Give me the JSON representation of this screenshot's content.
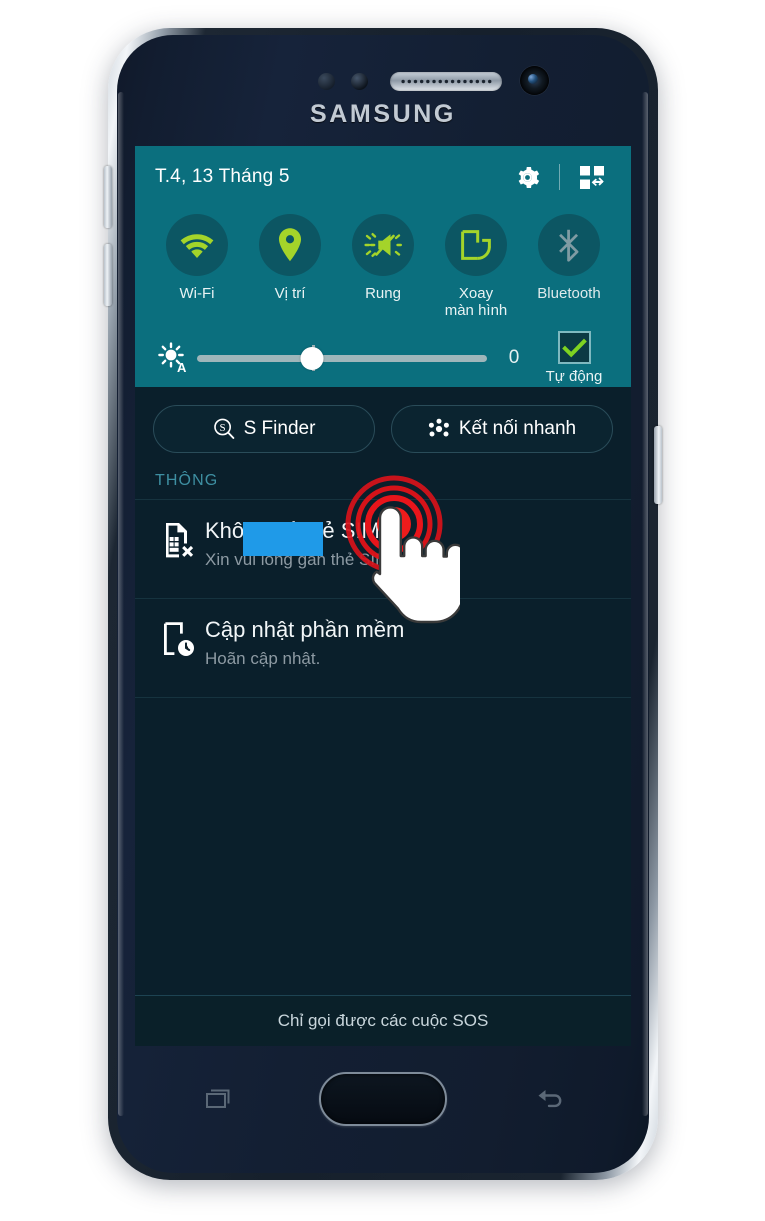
{
  "device": {
    "brand_logo": "SAMSUNG",
    "buttons": {
      "volume_up": "volume-up-button",
      "volume_down": "volume-down-button",
      "power": "power-button",
      "home": "home-button",
      "recents": "recents-key",
      "back": "back-key"
    }
  },
  "status_bar": {
    "date": "T.4, 13 Tháng 5",
    "settings_icon": "gear-icon",
    "edit_toggles_icon": "quick-settings-edit-icon"
  },
  "quick_toggles": [
    {
      "label": "Wi-Fi",
      "icon": "wifi-icon",
      "state": "on"
    },
    {
      "label": "Vị trí",
      "icon": "location-pin-icon",
      "state": "on"
    },
    {
      "label": "Rung",
      "icon": "vibrate-mute-icon",
      "state": "on"
    },
    {
      "label": "Xoay\nmàn hình",
      "label_line1": "Xoay",
      "label_line2": "màn hình",
      "icon": "screen-rotation-icon",
      "state": "on"
    },
    {
      "label": "Bluetooth",
      "icon": "bluetooth-icon",
      "state": "off"
    }
  ],
  "brightness": {
    "icon": "auto-brightness-icon",
    "value": "0",
    "auto_label": "Tự động",
    "auto_checked": true,
    "slider_percent": 40
  },
  "action_buttons": [
    {
      "label": "S Finder",
      "icon": "s-finder-icon"
    },
    {
      "label": "Kết nối nhanh",
      "icon": "quick-connect-icon"
    }
  ],
  "notifications": {
    "section_label": "THÔNG",
    "items": [
      {
        "icon": "sim-card-error-icon",
        "title": "Không có thẻ SIM",
        "title_visible": "Kh         ó thẻ SIM",
        "subtitle": "Xin vui lòng gắn thẻ SIM.",
        "redacted": true
      },
      {
        "icon": "software-update-icon",
        "title": "Cập nhật phần mềm",
        "subtitle": "Hoãn cập nhật.",
        "redacted": false
      }
    ]
  },
  "screen_bottom_bar": {
    "text": "Chỉ gọi được các cuộc SOS"
  },
  "overlay": {
    "tap_indicator": "tap-ripple",
    "cursor": "hand-cursor"
  },
  "colors": {
    "panel_teal": "#0b6f7e",
    "toggle_circle": "#0c5663",
    "toggle_on_icon": "#a4d42a",
    "toggle_off_icon": "#7f9ba3",
    "panel_dark": "#0a1f2b",
    "section_label": "#3e8fa2",
    "redaction_blue": "#1f9ae8",
    "tap_red": "#e0141a"
  }
}
